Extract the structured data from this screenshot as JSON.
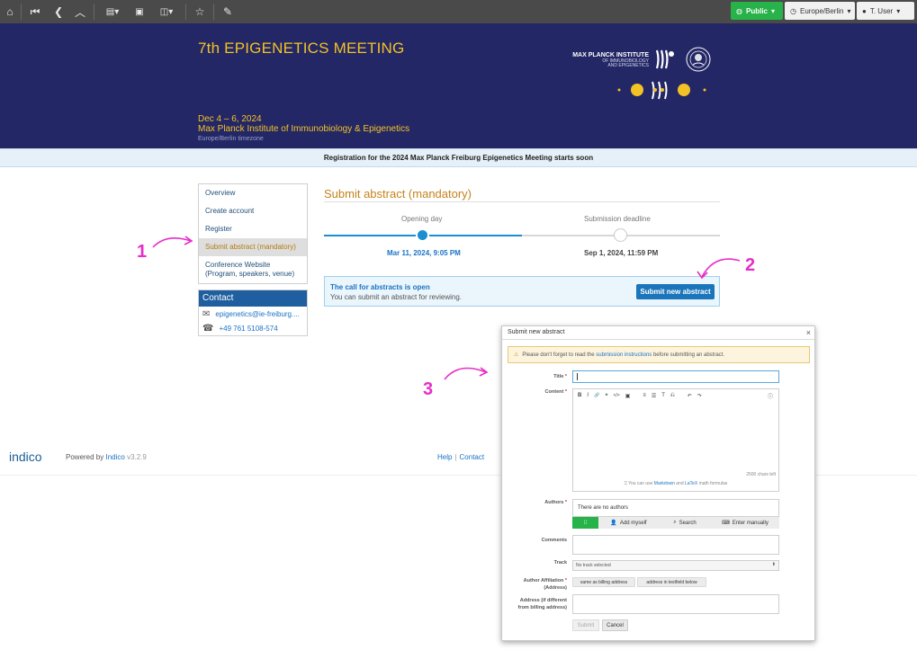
{
  "toolbar": {
    "public_label": "Public",
    "timezone_label": "Europe/Berlin",
    "user_label": "T. User",
    "icons": [
      "home-icon",
      "first-icon",
      "back-icon",
      "up-icon",
      "layout-icon",
      "calendar-icon",
      "view-icon",
      "star-icon",
      "edit-icon"
    ]
  },
  "header": {
    "title": "7th EPIGENETICS MEETING",
    "dates": "Dec 4 – 6, 2024",
    "venue": "Max Planck Institute of Immunobiology & Epigenetics",
    "timezone_note": "Europe/Berlin timezone",
    "institute_name": "MAX PLANCK INSTITUTE",
    "institute_sub1": "OF IMMUNOBIOLOGY",
    "institute_sub2": "AND EPIGENETICS"
  },
  "announcement": "Registration for the 2024 Max Planck Freiburg Epigenetics Meeting starts soon",
  "menu": {
    "items": [
      {
        "label": "Overview"
      },
      {
        "label": "Create account"
      },
      {
        "label": "Register"
      },
      {
        "label": "Submit abstract (mandatory)"
      },
      {
        "label": "Conference Website (Program, speakers, venue)"
      }
    ],
    "active_index": 3
  },
  "contact": {
    "heading": "Contact",
    "email": "epigenetics@ie-freiburg....",
    "phone": "+49 761 5108-574"
  },
  "main": {
    "title": "Submit abstract (mandatory)",
    "timeline": {
      "start_label": "Opening day",
      "start_date": "Mar 11, 2024, 9:05 PM",
      "end_label": "Submission deadline",
      "end_date": "Sep 1, 2024, 11:59 PM",
      "progress": 0.5
    },
    "cfa": {
      "title": "The call for abstracts is open",
      "text": "You can submit an abstract for reviewing.",
      "button": "Submit new abstract"
    }
  },
  "footer": {
    "logo_text": "indico",
    "powered_by": "Powered by",
    "indico_link": "Indico",
    "version": "v3.2.9",
    "help": "Help",
    "separator": "|",
    "contact": "Contact"
  },
  "annotations": [
    "1",
    "2",
    "3"
  ],
  "colors": {
    "annotation": "#e62ec8",
    "header_bg": "#232766",
    "accent_gold": "#f3c224",
    "link_blue": "#1a73c5",
    "public_green": "#27b34a"
  },
  "dialog": {
    "title": "Submit new abstract",
    "close": "×",
    "warning_pre": "Please don't forget to read the",
    "warning_link": "submission instructions",
    "warning_post": "before submitting an abstract.",
    "fields": {
      "title_label": "Title",
      "content_label": "Content",
      "authors_label": "Authors",
      "comments_label": "Comments",
      "track_label": "Track",
      "affiliation_label_1": "Author Affiliation",
      "affiliation_label_2": "(Address)",
      "address_label_1": "Address (if different",
      "address_label_2": "from billing address)"
    },
    "required_mark": "*",
    "editor": {
      "tools": [
        "B",
        "I",
        "🔗",
        "❝",
        "</>",
        "▣",
        "≡",
        "☰",
        "T",
        "⎌",
        "↶",
        "↷",
        "ⓘ"
      ],
      "chars_left": "2500 chars left",
      "hint_pre": "You can use",
      "hint_markdown": "Markdown",
      "hint_and": "and",
      "hint_latex": "LaTeX",
      "hint_post": "math formulas"
    },
    "authors": {
      "empty": "There are no authors",
      "add_myself": "Add myself",
      "search": "Search",
      "enter_manually": "Enter manually"
    },
    "track_value": "No track selected",
    "affiliation_options": [
      "same as billing address",
      "address in textfield below"
    ],
    "submit": "Submit",
    "cancel": "Cancel"
  }
}
